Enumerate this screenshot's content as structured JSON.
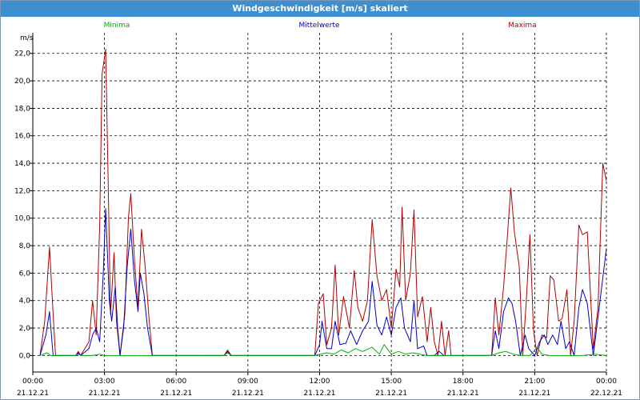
{
  "window": {
    "title": "Windgeschwindigkeit [m/s] skaliert"
  },
  "colors": {
    "minima": "#00b000",
    "mittel": "#0000cc",
    "maxima": "#b00000",
    "grid": "#000000"
  },
  "chart_data": {
    "type": "line",
    "title": "Windgeschwindigkeit [m/s] skaliert",
    "ylabel": "m/s",
    "ylim": [
      -1.2,
      23.5
    ],
    "xlim_hours": [
      0,
      24
    ],
    "y_ticks": [
      "0,0",
      "2,0",
      "4,0",
      "6,0",
      "8,0",
      "10,0",
      "12,0",
      "14,0",
      "16,0",
      "18,0",
      "20,0",
      "22,0"
    ],
    "y_tick_values": [
      0,
      2,
      4,
      6,
      8,
      10,
      12,
      14,
      16,
      18,
      20,
      22
    ],
    "x_ticks": [
      {
        "time": "00:00",
        "date": "21.12.21"
      },
      {
        "time": "03:00",
        "date": "21.12.21"
      },
      {
        "time": "06:00",
        "date": "21.12.21"
      },
      {
        "time": "09:00",
        "date": "21.12.21"
      },
      {
        "time": "12:00",
        "date": "21.12.21"
      },
      {
        "time": "15:00",
        "date": "21.12.21"
      },
      {
        "time": "18:00",
        "date": "21.12.21"
      },
      {
        "time": "21:00",
        "date": "21.12.21"
      },
      {
        "time": "00:00",
        "date": "22.12.21"
      }
    ],
    "x_tick_hours": [
      0,
      3,
      6,
      9,
      12,
      15,
      18,
      21,
      24
    ],
    "grid": true,
    "legend_placement": "top",
    "series": [
      {
        "name": "Minima",
        "points": [
          [
            0.3,
            0
          ],
          [
            0.6,
            0.2
          ],
          [
            0.75,
            0
          ],
          [
            1.8,
            0
          ],
          [
            1.9,
            0.1
          ],
          [
            2.0,
            0
          ],
          [
            2.5,
            0
          ],
          [
            2.8,
            0.1
          ],
          [
            3.0,
            0
          ],
          [
            4.5,
            0
          ],
          [
            5.0,
            0
          ],
          [
            6.0,
            0
          ],
          [
            8.0,
            0
          ],
          [
            8.15,
            0.2
          ],
          [
            8.3,
            0
          ],
          [
            11.8,
            0
          ],
          [
            12.3,
            0.2
          ],
          [
            12.6,
            0.1
          ],
          [
            12.9,
            0.4
          ],
          [
            13.2,
            0.2
          ],
          [
            13.5,
            0.5
          ],
          [
            13.8,
            0.3
          ],
          [
            14.2,
            0.6
          ],
          [
            14.5,
            0.1
          ],
          [
            14.7,
            0.8
          ],
          [
            15.0,
            0.1
          ],
          [
            15.3,
            0.3
          ],
          [
            15.6,
            0.1
          ],
          [
            15.9,
            0.2
          ],
          [
            16.2,
            0.1
          ],
          [
            16.5,
            0
          ],
          [
            18.0,
            0
          ],
          [
            19.2,
            0
          ],
          [
            19.5,
            0.2
          ],
          [
            19.8,
            0.3
          ],
          [
            20.1,
            0.1
          ],
          [
            20.4,
            0
          ],
          [
            20.8,
            0
          ],
          [
            21.1,
            0.6
          ],
          [
            21.3,
            0.1
          ],
          [
            21.6,
            0
          ],
          [
            23.0,
            0
          ],
          [
            23.5,
            0.1
          ],
          [
            24.0,
            0
          ]
        ]
      },
      {
        "name": "Mittelwerte",
        "points": [
          [
            0.3,
            0
          ],
          [
            0.55,
            1.5
          ],
          [
            0.7,
            3.2
          ],
          [
            0.85,
            0
          ],
          [
            1.8,
            0
          ],
          [
            1.9,
            0.2
          ],
          [
            2.0,
            0
          ],
          [
            2.35,
            0.5
          ],
          [
            2.5,
            1.5
          ],
          [
            2.65,
            2.0
          ],
          [
            2.8,
            1.0
          ],
          [
            2.95,
            6.0
          ],
          [
            3.05,
            10.7
          ],
          [
            3.2,
            4.0
          ],
          [
            3.3,
            2.5
          ],
          [
            3.45,
            5.0
          ],
          [
            3.55,
            2.0
          ],
          [
            3.65,
            0
          ],
          [
            3.8,
            2.0
          ],
          [
            3.95,
            6.5
          ],
          [
            4.1,
            9.2
          ],
          [
            4.25,
            5.5
          ],
          [
            4.4,
            3.2
          ],
          [
            4.5,
            6.0
          ],
          [
            4.65,
            4.5
          ],
          [
            4.8,
            2.0
          ],
          [
            5.0,
            0
          ],
          [
            6.0,
            0
          ],
          [
            8.0,
            0
          ],
          [
            8.15,
            0.3
          ],
          [
            8.3,
            0
          ],
          [
            11.8,
            0
          ],
          [
            12.0,
            0.8
          ],
          [
            12.1,
            2.5
          ],
          [
            12.3,
            0.5
          ],
          [
            12.5,
            0.5
          ],
          [
            12.65,
            2.5
          ],
          [
            12.85,
            0.8
          ],
          [
            13.1,
            0.9
          ],
          [
            13.3,
            1.8
          ],
          [
            13.55,
            0.8
          ],
          [
            13.8,
            1.8
          ],
          [
            14.05,
            2.5
          ],
          [
            14.2,
            5.4
          ],
          [
            14.4,
            2.2
          ],
          [
            14.6,
            1.5
          ],
          [
            14.8,
            2.8
          ],
          [
            15.0,
            1.5
          ],
          [
            15.2,
            3.5
          ],
          [
            15.4,
            4.2
          ],
          [
            15.55,
            2.0
          ],
          [
            15.8,
            1.0
          ],
          [
            15.95,
            4.0
          ],
          [
            16.1,
            0.5
          ],
          [
            16.35,
            0.7
          ],
          [
            16.5,
            0
          ],
          [
            16.8,
            0
          ],
          [
            17.0,
            0.3
          ],
          [
            17.2,
            0
          ],
          [
            19.2,
            0
          ],
          [
            19.35,
            1.8
          ],
          [
            19.5,
            0.5
          ],
          [
            19.7,
            3.2
          ],
          [
            19.9,
            4.2
          ],
          [
            20.05,
            3.8
          ],
          [
            20.2,
            2.5
          ],
          [
            20.4,
            0
          ],
          [
            20.6,
            1.5
          ],
          [
            20.75,
            0.5
          ],
          [
            21.0,
            0
          ],
          [
            21.2,
            1.0
          ],
          [
            21.4,
            1.5
          ],
          [
            21.55,
            0.8
          ],
          [
            21.75,
            1.5
          ],
          [
            21.95,
            0.8
          ],
          [
            22.1,
            2.5
          ],
          [
            22.3,
            0.5
          ],
          [
            22.45,
            1.0
          ],
          [
            22.65,
            0
          ],
          [
            22.85,
            3.5
          ],
          [
            23.0,
            4.8
          ],
          [
            23.2,
            3.8
          ],
          [
            23.45,
            0
          ],
          [
            23.7,
            3.5
          ],
          [
            24.0,
            7.8
          ]
        ]
      },
      {
        "name": "Maxima",
        "points": [
          [
            0.3,
            0
          ],
          [
            0.5,
            2.5
          ],
          [
            0.7,
            7.9
          ],
          [
            0.85,
            3.0
          ],
          [
            0.95,
            0
          ],
          [
            1.8,
            0
          ],
          [
            1.9,
            0.3
          ],
          [
            2.0,
            0
          ],
          [
            2.35,
            1.0
          ],
          [
            2.5,
            4.0
          ],
          [
            2.65,
            1.5
          ],
          [
            2.8,
            9.5
          ],
          [
            2.9,
            20.5
          ],
          [
            3.05,
            22.3
          ],
          [
            3.15,
            13.0
          ],
          [
            3.25,
            3.0
          ],
          [
            3.4,
            7.5
          ],
          [
            3.5,
            2.5
          ],
          [
            3.65,
            0
          ],
          [
            3.85,
            3.0
          ],
          [
            4.0,
            10.0
          ],
          [
            4.1,
            11.8
          ],
          [
            4.25,
            7.0
          ],
          [
            4.4,
            3.5
          ],
          [
            4.55,
            9.2
          ],
          [
            4.7,
            6.5
          ],
          [
            4.85,
            3.0
          ],
          [
            5.0,
            0
          ],
          [
            6.0,
            0
          ],
          [
            8.0,
            0
          ],
          [
            8.15,
            0.4
          ],
          [
            8.3,
            0
          ],
          [
            11.8,
            0
          ],
          [
            11.95,
            3.8
          ],
          [
            12.15,
            4.5
          ],
          [
            12.3,
            0.8
          ],
          [
            12.5,
            2.0
          ],
          [
            12.65,
            6.6
          ],
          [
            12.8,
            1.5
          ],
          [
            13.0,
            4.3
          ],
          [
            13.25,
            2.0
          ],
          [
            13.45,
            6.2
          ],
          [
            13.6,
            3.5
          ],
          [
            13.8,
            2.5
          ],
          [
            14.0,
            4.0
          ],
          [
            14.2,
            9.9
          ],
          [
            14.4,
            5.8
          ],
          [
            14.6,
            4.0
          ],
          [
            14.8,
            4.8
          ],
          [
            15.0,
            2.0
          ],
          [
            15.2,
            6.3
          ],
          [
            15.35,
            5.0
          ],
          [
            15.45,
            10.8
          ],
          [
            15.6,
            4.0
          ],
          [
            15.8,
            6.0
          ],
          [
            15.95,
            10.6
          ],
          [
            16.1,
            2.8
          ],
          [
            16.3,
            4.3
          ],
          [
            16.5,
            1.0
          ],
          [
            16.65,
            3.5
          ],
          [
            16.8,
            1.0
          ],
          [
            16.95,
            0
          ],
          [
            17.1,
            2.5
          ],
          [
            17.25,
            0
          ],
          [
            17.4,
            1.8
          ],
          [
            17.5,
            0
          ],
          [
            19.2,
            0
          ],
          [
            19.35,
            4.2
          ],
          [
            19.5,
            1.5
          ],
          [
            19.7,
            5.0
          ],
          [
            19.85,
            8.5
          ],
          [
            20.0,
            12.2
          ],
          [
            20.15,
            9.0
          ],
          [
            20.35,
            6.5
          ],
          [
            20.5,
            0
          ],
          [
            20.65,
            4.0
          ],
          [
            20.8,
            8.8
          ],
          [
            20.95,
            1.8
          ],
          [
            21.1,
            0
          ],
          [
            21.3,
            1.5
          ],
          [
            21.5,
            1.3
          ],
          [
            21.65,
            5.8
          ],
          [
            21.8,
            5.5
          ],
          [
            22.0,
            2.5
          ],
          [
            22.15,
            2.7
          ],
          [
            22.35,
            4.8
          ],
          [
            22.5,
            0
          ],
          [
            22.65,
            2.5
          ],
          [
            22.85,
            9.5
          ],
          [
            23.0,
            8.8
          ],
          [
            23.2,
            9.0
          ],
          [
            23.45,
            0.5
          ],
          [
            23.65,
            3.5
          ],
          [
            23.85,
            14.0
          ],
          [
            24.0,
            12.7
          ]
        ]
      }
    ]
  }
}
